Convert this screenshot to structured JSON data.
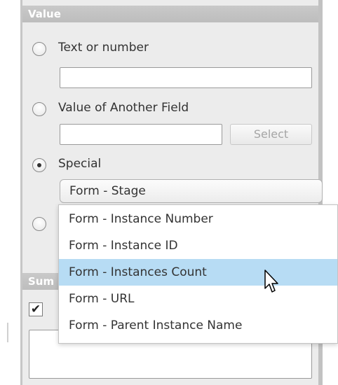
{
  "value_section": {
    "title": "Value",
    "options": [
      {
        "label": "Text or number",
        "selected": false
      },
      {
        "label": "Value of Another Field",
        "selected": false
      },
      {
        "label": "Special",
        "selected": true
      },
      {
        "label": "",
        "selected": false
      }
    ],
    "text_value": "",
    "field_value": "",
    "select_button_label": "Select",
    "special_value": "Form - Stage",
    "special_options": [
      "Form - Instance Number",
      "Form - Instance ID",
      "Form - Instances Count",
      "Form - URL",
      "Form - Parent Instance Name"
    ],
    "highlighted_option": "Form - Instances Count"
  },
  "summary_section": {
    "title": "Sum",
    "checkbox_checked": true,
    "checkbox_glyph": "✔",
    "notes_value": ""
  },
  "colors": {
    "highlight": "#b7dcf4",
    "header": "#c4c4c4"
  }
}
